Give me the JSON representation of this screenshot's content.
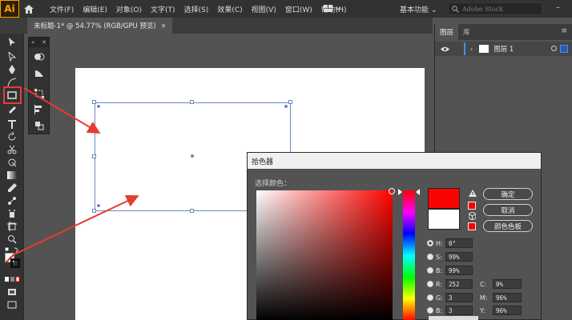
{
  "app": {
    "logo": "Ai"
  },
  "menu": {
    "items": [
      "文件(F)",
      "编辑(E)",
      "对象(O)",
      "文字(T)",
      "选择(S)",
      "效果(C)",
      "视图(V)",
      "窗口(W)",
      "帮助(H)"
    ],
    "workspace": "基本功能",
    "search_placeholder": "Adobe Stock",
    "minimize": "–"
  },
  "document": {
    "tab_label": "未标题-1* @ 54.77% (RGB/GPU 预览)",
    "tab_close": "✕"
  },
  "float_panel": {
    "collapse": "«",
    "close": "✕"
  },
  "layers": {
    "tabs": [
      "图层",
      "库"
    ],
    "menu": "≡",
    "layer_name": "图层 1",
    "chevron": "›"
  },
  "picker": {
    "title": "拾色器",
    "select_label": "选择颜色：",
    "new_color": "#fc0303",
    "old_color": "#ffffff",
    "buttons": {
      "ok": "确定",
      "cancel": "取消",
      "swatches": "颜色色板"
    },
    "hsb": [
      {
        "label": "H:",
        "value": "0°",
        "selected": true
      },
      {
        "label": "S:",
        "value": "99%",
        "selected": false
      },
      {
        "label": "B:",
        "value": "99%",
        "selected": false
      }
    ],
    "rgb": [
      {
        "label": "R:",
        "value": "252"
      },
      {
        "label": "G:",
        "value": "3"
      },
      {
        "label": "B:",
        "value": "3"
      }
    ],
    "cmyk": [
      {
        "label": "C:",
        "value": "0%"
      },
      {
        "label": "M:",
        "value": "96%"
      },
      {
        "label": "Y:",
        "value": "96%"
      }
    ]
  },
  "colors": {
    "highlight": "#e83c2e",
    "selection": "#6c86c7",
    "accent": "#4b8bf5"
  }
}
